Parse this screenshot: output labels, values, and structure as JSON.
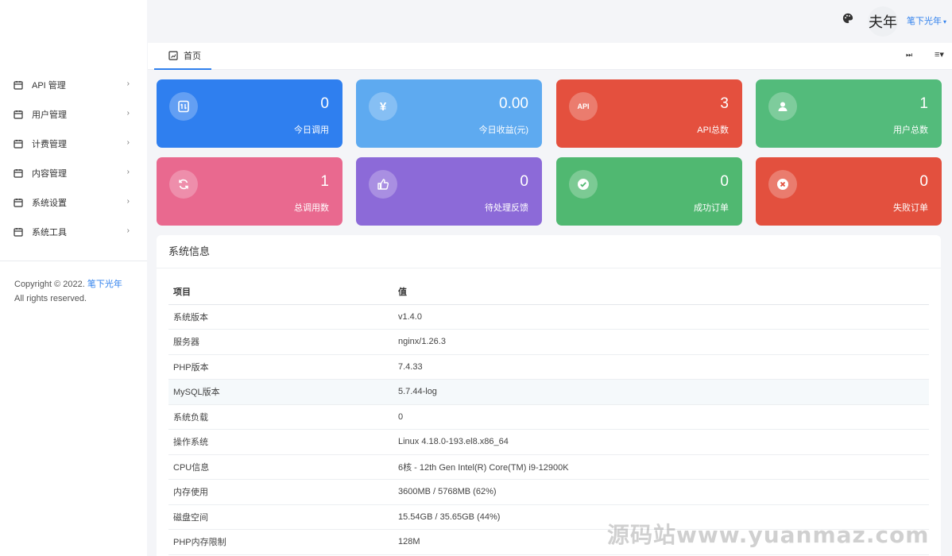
{
  "header": {
    "user_name": "笔下光年",
    "avatar_text": "夫年",
    "caret": "▾"
  },
  "sidebar": {
    "items": [
      {
        "label": "API 管理",
        "arrow": "›"
      },
      {
        "label": "用户管理",
        "arrow": "›"
      },
      {
        "label": "计费管理",
        "arrow": "›"
      },
      {
        "label": "内容管理",
        "arrow": "›"
      },
      {
        "label": "系统设置",
        "arrow": "›"
      },
      {
        "label": "系统工具",
        "arrow": "›"
      }
    ],
    "copyright_prefix": "Copyright © 2022.",
    "copyright_brand": "笔下光年",
    "copyright_suffix": "All rights reserved."
  },
  "tabs": {
    "home_label": "首页",
    "skip_icon": "⏭",
    "menu_icon": "≡▾"
  },
  "stats": [
    {
      "value": "0",
      "label": "今日调用",
      "color": "#2f7fef",
      "icon": "exchange-icon"
    },
    {
      "value": "0.00",
      "label": "今日收益(元)",
      "color": "#5eaaf0",
      "icon": "yen-icon",
      "glyph": "¥"
    },
    {
      "value": "3",
      "label": "API总数",
      "color": "#e4503e",
      "icon": "api-icon",
      "glyph": "API"
    },
    {
      "value": "1",
      "label": "用户总数",
      "color": "#53bb7b",
      "icon": "user-icon"
    },
    {
      "value": "1",
      "label": "总调用数",
      "color": "#e9698f",
      "icon": "refresh-icon"
    },
    {
      "value": "0",
      "label": "待处理反馈",
      "color": "#8c6ad8",
      "icon": "thumbs-up-icon"
    },
    {
      "value": "0",
      "label": "成功订单",
      "color": "#50b871",
      "icon": "check-circle-icon"
    },
    {
      "value": "0",
      "label": "失败订单",
      "color": "#e3503e",
      "icon": "x-circle-icon"
    }
  ],
  "system_info": {
    "title": "系统信息",
    "headers": [
      "项目",
      "值"
    ],
    "rows": [
      [
        "系统版本",
        "v1.4.0"
      ],
      [
        "服务器",
        "nginx/1.26.3"
      ],
      [
        "PHP版本",
        "7.4.33"
      ],
      [
        "MySQL版本",
        "5.7.44-log"
      ],
      [
        "系统负载",
        "0"
      ],
      [
        "操作系统",
        "Linux 4.18.0-193.el8.x86_64"
      ],
      [
        "CPU信息",
        "6核 - 12th Gen Intel(R) Core(TM) i9-12900K"
      ],
      [
        "内存使用",
        "3600MB / 5768MB (62%)"
      ],
      [
        "磁盘空间",
        "15.54GB / 35.65GB (44%)"
      ],
      [
        "PHP内存限制",
        "128M"
      ]
    ]
  },
  "watermark": "源码站www.yuanmaz.com"
}
